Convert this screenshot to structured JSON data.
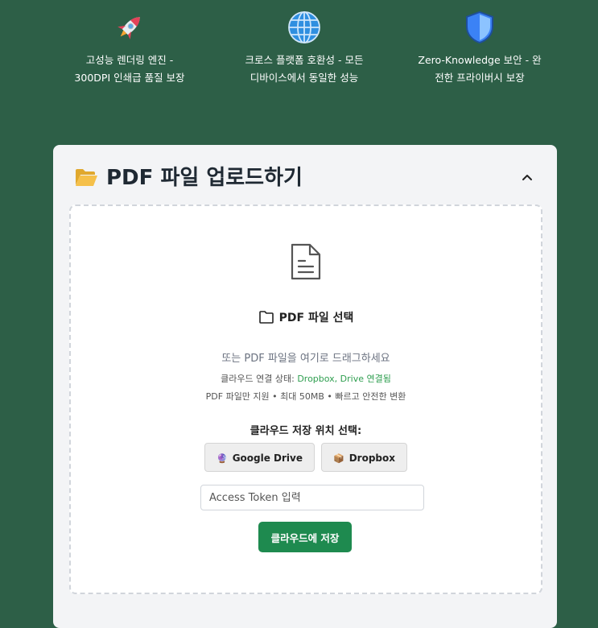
{
  "features": [
    {
      "icon": "rocket-icon",
      "line1": "고성능 렌더링 엔진 -",
      "line2": "300DPI 인쇄급 품질 보장"
    },
    {
      "icon": "globe-icon",
      "line1": "크로스 플랫폼 호환성 - 모든",
      "line2": "디바이스에서 동일한 성능"
    },
    {
      "icon": "shield-icon",
      "line1": "Zero-Knowledge 보안 - 완",
      "line2": "전한 프라이버시 보장"
    }
  ],
  "upload": {
    "title": "PDF 파일 업로드하기",
    "select_label": "PDF 파일 선택",
    "drag_hint": "또는 PDF 파일을 여기로 드래그하세요",
    "cloud_status_label": "클라우드 연결 상태: ",
    "cloud_status_value": "Dropbox, Drive 연결됨",
    "limits": "PDF 파일만 지원 • 최대 50MB • 빠르고 안전한 변환"
  },
  "cloud": {
    "label": "클라우드 저장 위치 선택:",
    "google_drive": "Google Drive",
    "dropbox": "Dropbox",
    "token_placeholder": "Access Token 입력",
    "save_label": "클라우드에 저장"
  },
  "colors": {
    "background": "#2d5f47",
    "card": "#f3f4f6",
    "accent_green": "#1e8a4f",
    "status_green": "#2e9e4f"
  }
}
